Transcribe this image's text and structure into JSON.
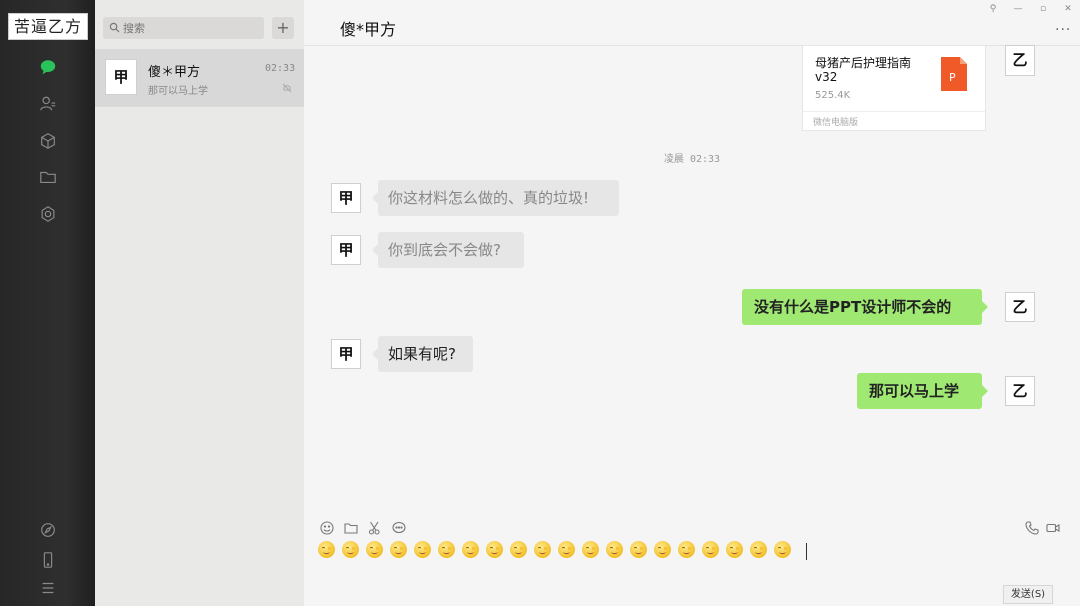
{
  "brand": {
    "logo_text": "苦逼乙方"
  },
  "nav": {
    "icons": [
      "chat-icon",
      "contacts-icon",
      "box-icon",
      "folder-icon",
      "settings-icon",
      "compass-icon",
      "phone-icon",
      "menu-icon"
    ]
  },
  "sidebar": {
    "search_placeholder": "搜索",
    "add_label": "+",
    "conversations": [
      {
        "avatar": "甲",
        "name": "傻＊甲方",
        "time": "02:33",
        "preview": "那可以马上学"
      }
    ]
  },
  "chat": {
    "title": "傻*甲方",
    "more_label": "···",
    "window_controls": [
      "⚲",
      "—",
      "▫",
      "✕"
    ],
    "file_message": {
      "name": "母猪产后护理指南v32",
      "size": "525.4K",
      "source": "微信电脑版",
      "icon_letter": "P",
      "sender_avatar": "乙"
    },
    "timestamp": "凌晨 02:33",
    "messages": [
      {
        "from": "them",
        "avatar": "甲",
        "text": "你这材料怎么做的、真的垃圾!"
      },
      {
        "from": "them",
        "avatar": "甲",
        "text": "你到底会不会做?"
      },
      {
        "from": "me",
        "avatar": "乙",
        "text": "没有什么是PPT设计师不会的"
      },
      {
        "from": "them",
        "avatar": "甲",
        "text": "如果有呢?"
      },
      {
        "from": "me",
        "avatar": "乙",
        "text": "那可以马上学"
      }
    ]
  },
  "composer": {
    "tools": [
      "emoji-icon",
      "folder-icon",
      "scissors-icon",
      "chat-bubble-icon"
    ],
    "right_tools": [
      "phone-icon",
      "video-icon"
    ],
    "emoji_count": 20,
    "send_label": "发送(S)"
  },
  "colors": {
    "bubble_out": "#9fe872",
    "bubble_in": "#e6e6e6",
    "nav_bg": "#2b2b2b",
    "file_icon": "#f05a28"
  }
}
